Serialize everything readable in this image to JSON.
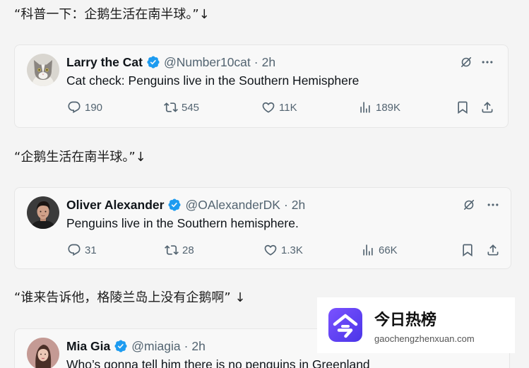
{
  "captions": [
    "“科普一下：企鹅生活在南半球。”↓",
    "“企鹅生活在南半球。”↓",
    "“谁来告诉他，格陵兰岛上没有企鹅啊” ↓"
  ],
  "ui": {
    "dot": "·"
  },
  "tweets": [
    {
      "name": "Larry the Cat",
      "verified": true,
      "handle": "@Number10cat",
      "time": "2h",
      "text": "Cat check: Penguins live in the Southern Hemisphere",
      "replies": "190",
      "reposts": "545",
      "likes": "11K",
      "views": "189K",
      "avatar_icon": "cat-avatar"
    },
    {
      "name": "Oliver Alexander",
      "verified": true,
      "handle": "@OAlexanderDK",
      "time": "2h",
      "text": "Penguins live in the Southern hemisphere.",
      "replies": "31",
      "reposts": "28",
      "likes": "1.3K",
      "views": "66K",
      "avatar_icon": "person-avatar"
    },
    {
      "name": "Mia Gia",
      "verified": true,
      "handle": "@miagia",
      "time": "2h",
      "text": "Who’s gonna tell him there is no penguins in Greenland",
      "avatar_icon": "person-avatar"
    }
  ],
  "icons": {
    "reply": "reply-icon",
    "repost": "repost-icon",
    "like": "heart-icon",
    "views": "bar-chart-icon",
    "bookmark": "bookmark-icon",
    "share": "share-icon",
    "grok": "grok-icon",
    "more": "more-dots-icon",
    "verified": "verified-badge-icon"
  },
  "watermark": {
    "title": "今日热榜",
    "domain": "gaochengzhenxuan.com",
    "logo_icon": "jinri-rebang-logo"
  },
  "colors": {
    "background": "#f4f4f4",
    "card": "#f8f8f8",
    "text": "#0f1419",
    "secondary": "#536471",
    "verified": "#1d9bf0",
    "watermark_accent": "#5b3df4"
  }
}
